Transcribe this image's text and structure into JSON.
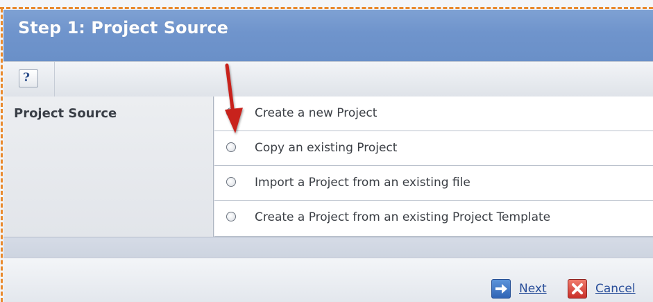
{
  "window": {
    "title": "Step 1: Project Source"
  },
  "toolbar": {
    "help_icon": "help-icon",
    "help_glyph": "?"
  },
  "form": {
    "field_label": "Project Source",
    "selected_index": null,
    "options": [
      {
        "label": "Create a new Project"
      },
      {
        "label": "Copy an existing Project"
      },
      {
        "label": "Import a Project from an existing file"
      },
      {
        "label": "Create a Project from an existing Project Template"
      }
    ]
  },
  "annotation": {
    "arrow_color": "#c8211d"
  },
  "footer": {
    "next_label": "Next",
    "next_icon": "arrow-right-icon",
    "cancel_label": "Cancel",
    "cancel_icon": "close-icon"
  },
  "colors": {
    "title_bar": "#6f94cc",
    "dashed_border": "#e98a2e",
    "link": "#2a4f9a"
  }
}
